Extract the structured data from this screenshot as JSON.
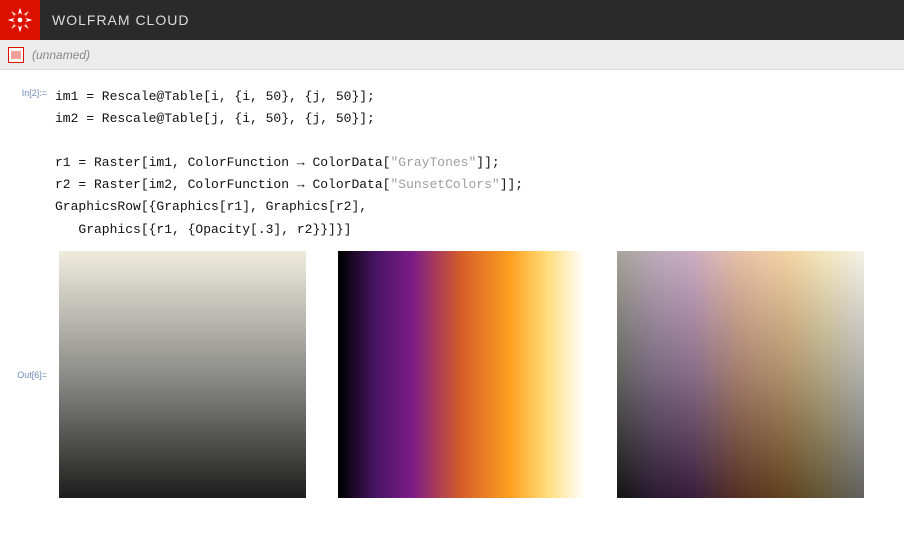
{
  "header": {
    "title": "WOLFRAM CLOUD"
  },
  "tab": {
    "label": "(unnamed)"
  },
  "input": {
    "label": "In[2]:=",
    "lines": [
      [
        {
          "t": "im1 = Rescale@Table[i, {i, 50}, {j, 50}];"
        }
      ],
      [
        {
          "t": "im2 = Rescale@Table[j, {i, 50}, {j, 50}];"
        }
      ],
      [
        {
          "t": ""
        }
      ],
      [
        {
          "t": "r1 = Raster[im1, ColorFunction → ColorData["
        },
        {
          "t": "\"GrayTones\"",
          "c": "code-str"
        },
        {
          "t": "]];"
        }
      ],
      [
        {
          "t": "r2 = Raster[im2, ColorFunction → ColorData["
        },
        {
          "t": "\"SunsetColors\"",
          "c": "code-str"
        },
        {
          "t": "]];"
        }
      ],
      [
        {
          "t": "GraphicsRow[{Graphics[r1], Graphics[r2], "
        }
      ],
      [
        {
          "t": "   Graphics[{r1, {Opacity[.3], r2}}]}]"
        }
      ]
    ]
  },
  "output": {
    "label": "Out[6]="
  },
  "graphics": {
    "size": 50,
    "opacity_overlay": 0.3,
    "panels": [
      {
        "id": "g1",
        "kind": "gray-vert"
      },
      {
        "id": "g2",
        "kind": "sunset-horiz"
      },
      {
        "id": "g3",
        "kind": "blend"
      }
    ],
    "graytones": [
      {
        "p": 0.0,
        "r": 0.937,
        "g": 0.925,
        "b": 0.87
      },
      {
        "p": 0.5,
        "r": 0.552,
        "g": 0.552,
        "b": 0.54
      },
      {
        "p": 1.0,
        "r": 0.117,
        "g": 0.117,
        "b": 0.117
      }
    ],
    "sunsetcolors": [
      {
        "p": 0.0,
        "r": 0.0,
        "g": 0.0,
        "b": 0.0
      },
      {
        "p": 0.15,
        "r": 0.28,
        "g": 0.08,
        "b": 0.39
      },
      {
        "p": 0.3,
        "r": 0.49,
        "g": 0.11,
        "b": 0.53
      },
      {
        "p": 0.5,
        "r": 0.84,
        "g": 0.37,
        "b": 0.16
      },
      {
        "p": 0.7,
        "r": 1.0,
        "g": 0.63,
        "b": 0.13
      },
      {
        "p": 0.85,
        "r": 1.0,
        "g": 0.87,
        "b": 0.49
      },
      {
        "p": 1.0,
        "r": 1.0,
        "g": 1.0,
        "b": 1.0
      }
    ]
  }
}
